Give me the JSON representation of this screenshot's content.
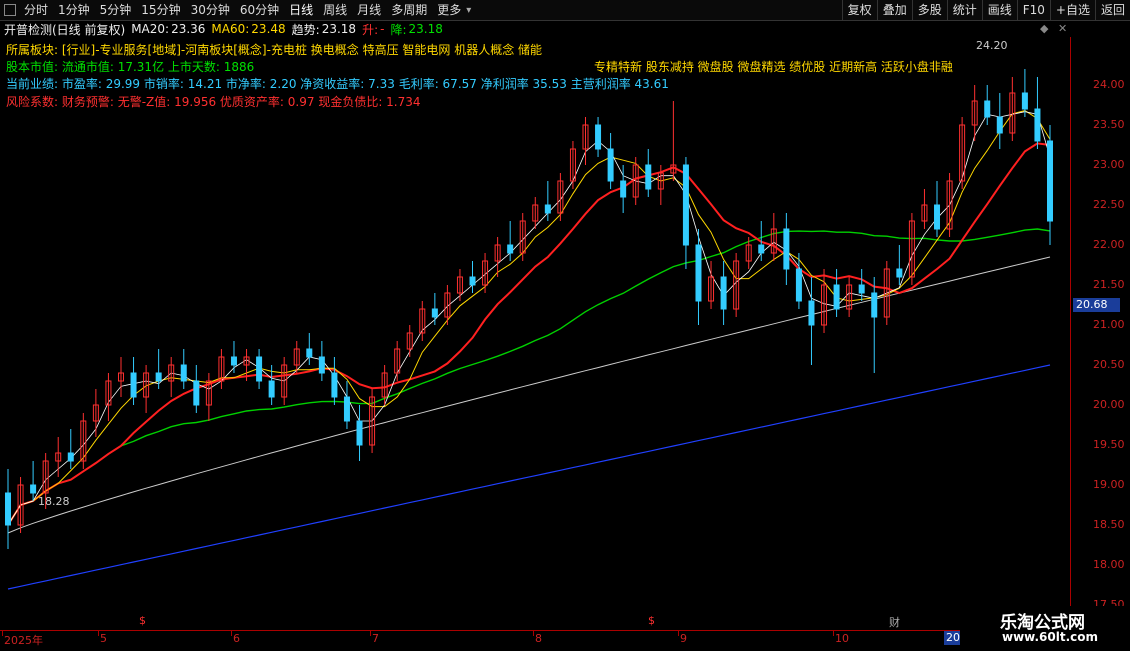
{
  "toolbar": {
    "periods": [
      "分时",
      "1分钟",
      "5分钟",
      "15分钟",
      "30分钟",
      "60分钟",
      "日线",
      "周线",
      "月线",
      "多周期",
      "更多"
    ],
    "active": "日线",
    "right_buttons": [
      "复权",
      "叠加",
      "多股",
      "统计",
      "画线",
      "F10",
      "+自选",
      "返回"
    ]
  },
  "info_bar": {
    "title": "开普检测(日线 前复权)",
    "ma20_label": "MA20:",
    "ma20_value": "23.36",
    "ma60_label": "MA60:",
    "ma60_value": "23.48",
    "trend_label": "趋势:",
    "trend_value": "23.18",
    "up_label": "升:",
    "up_value": "-",
    "down_label": "降:",
    "down_value": "23.18"
  },
  "info_lines": {
    "sector": "所属板块: [行业]-专业服务[地域]-河南板块[概念]-充电桩 换电概念 特高压 智能电网 机器人概念 储能",
    "market_cap": "股本市值: 流通市值: 17.31亿 上市天数: 1886",
    "performance": "当前业绩: 市盈率: 29.99 市销率: 14.21 市净率: 2.20 净资收益率: 7.33 毛利率: 67.57 净利润率 35.53 主营利润率 43.61",
    "risk": "风险系数: 财务预警: 无警-Z值: 19.956 优质资产率: 0.97 现金负债比: 1.734"
  },
  "tags": "专精特新 股东减持 微盘股 微盘精选 绩优股 近期新高 活跃小盘非融",
  "price_axis": {
    "ticks": [
      "24.00",
      "23.50",
      "23.00",
      "22.50",
      "22.00",
      "21.50",
      "21.00",
      "20.50",
      "20.00",
      "19.50",
      "19.00",
      "18.50",
      "18.00",
      "17.50"
    ],
    "current": "20.68"
  },
  "date_axis": {
    "labels": [
      "2025年",
      "5",
      "6",
      "7",
      "8",
      "9",
      "10"
    ],
    "badge": "2025/1"
  },
  "annotations": {
    "high": "24.20",
    "low": "18.28"
  },
  "event_markers": [
    "$",
    "$"
  ],
  "fin_marker": "财",
  "watermark": {
    "line1": "乐淘公式网",
    "line2": "www.60lt.com"
  },
  "colors": {
    "up": "#ff3030",
    "down": "#33ccff",
    "ma_yellow": "#ffd800",
    "ma_red": "#ff2020",
    "ma_green": "#00d000",
    "ma_grey": "#cccccc",
    "ma_blue": "#2040ff"
  },
  "chart_data": {
    "type": "candlestick",
    "ylim": [
      17.5,
      24.5
    ],
    "ohlc": [
      [
        18.9,
        19.2,
        18.2,
        18.5
      ],
      [
        18.5,
        19.1,
        18.4,
        19.0
      ],
      [
        19.0,
        19.3,
        18.8,
        18.9
      ],
      [
        18.9,
        19.4,
        18.7,
        19.3
      ],
      [
        19.3,
        19.6,
        19.1,
        19.4
      ],
      [
        19.4,
        19.7,
        19.2,
        19.3
      ],
      [
        19.3,
        19.9,
        19.2,
        19.8
      ],
      [
        19.8,
        20.2,
        19.6,
        20.0
      ],
      [
        20.0,
        20.4,
        19.8,
        20.3
      ],
      [
        20.3,
        20.6,
        20.1,
        20.4
      ],
      [
        20.4,
        20.6,
        20.0,
        20.1
      ],
      [
        20.1,
        20.5,
        19.9,
        20.4
      ],
      [
        20.4,
        20.7,
        20.2,
        20.3
      ],
      [
        20.3,
        20.6,
        20.1,
        20.5
      ],
      [
        20.5,
        20.7,
        20.2,
        20.3
      ],
      [
        20.3,
        20.5,
        19.9,
        20.0
      ],
      [
        20.0,
        20.4,
        19.8,
        20.3
      ],
      [
        20.3,
        20.7,
        20.2,
        20.6
      ],
      [
        20.6,
        20.8,
        20.4,
        20.5
      ],
      [
        20.5,
        20.7,
        20.3,
        20.6
      ],
      [
        20.6,
        20.7,
        20.2,
        20.3
      ],
      [
        20.3,
        20.5,
        20.0,
        20.1
      ],
      [
        20.1,
        20.6,
        20.0,
        20.5
      ],
      [
        20.5,
        20.8,
        20.4,
        20.7
      ],
      [
        20.7,
        20.9,
        20.5,
        20.6
      ],
      [
        20.6,
        20.8,
        20.3,
        20.4
      ],
      [
        20.4,
        20.6,
        20.0,
        20.1
      ],
      [
        20.1,
        20.3,
        19.7,
        19.8
      ],
      [
        19.8,
        20.0,
        19.3,
        19.5
      ],
      [
        19.5,
        20.2,
        19.4,
        20.1
      ],
      [
        20.1,
        20.5,
        20.0,
        20.4
      ],
      [
        20.4,
        20.8,
        20.3,
        20.7
      ],
      [
        20.7,
        21.0,
        20.6,
        20.9
      ],
      [
        20.9,
        21.3,
        20.8,
        21.2
      ],
      [
        21.2,
        21.4,
        21.0,
        21.1
      ],
      [
        21.1,
        21.5,
        21.0,
        21.4
      ],
      [
        21.4,
        21.7,
        21.3,
        21.6
      ],
      [
        21.6,
        21.8,
        21.4,
        21.5
      ],
      [
        21.5,
        21.9,
        21.4,
        21.8
      ],
      [
        21.8,
        22.1,
        21.6,
        22.0
      ],
      [
        22.0,
        22.3,
        21.8,
        21.9
      ],
      [
        21.9,
        22.4,
        21.8,
        22.3
      ],
      [
        22.3,
        22.6,
        22.2,
        22.5
      ],
      [
        22.5,
        22.8,
        22.3,
        22.4
      ],
      [
        22.4,
        22.9,
        22.3,
        22.8
      ],
      [
        22.8,
        23.3,
        22.7,
        23.2
      ],
      [
        23.2,
        23.6,
        23.0,
        23.5
      ],
      [
        23.5,
        23.6,
        23.1,
        23.2
      ],
      [
        23.2,
        23.4,
        22.7,
        22.8
      ],
      [
        22.8,
        23.0,
        22.4,
        22.6
      ],
      [
        22.6,
        23.1,
        22.5,
        23.0
      ],
      [
        23.0,
        23.2,
        22.6,
        22.7
      ],
      [
        22.7,
        23.0,
        22.5,
        22.9
      ],
      [
        22.9,
        23.8,
        22.8,
        23.0
      ],
      [
        23.0,
        23.1,
        21.7,
        22.0
      ],
      [
        22.0,
        22.2,
        21.0,
        21.3
      ],
      [
        21.3,
        21.8,
        21.2,
        21.6
      ],
      [
        21.6,
        21.8,
        21.0,
        21.2
      ],
      [
        21.2,
        21.9,
        21.1,
        21.8
      ],
      [
        21.8,
        22.1,
        21.7,
        22.0
      ],
      [
        22.0,
        22.3,
        21.8,
        21.9
      ],
      [
        21.9,
        22.4,
        21.8,
        22.2
      ],
      [
        22.2,
        22.4,
        21.5,
        21.7
      ],
      [
        21.7,
        21.9,
        21.2,
        21.3
      ],
      [
        21.3,
        21.6,
        20.5,
        21.0
      ],
      [
        21.0,
        21.7,
        20.9,
        21.5
      ],
      [
        21.5,
        21.7,
        21.1,
        21.2
      ],
      [
        21.2,
        21.6,
        21.1,
        21.5
      ],
      [
        21.5,
        21.7,
        21.3,
        21.4
      ],
      [
        21.4,
        21.6,
        20.4,
        21.1
      ],
      [
        21.1,
        21.8,
        21.0,
        21.7
      ],
      [
        21.7,
        22.0,
        21.5,
        21.6
      ],
      [
        21.6,
        22.4,
        21.5,
        22.3
      ],
      [
        22.3,
        22.7,
        22.2,
        22.5
      ],
      [
        22.5,
        22.8,
        22.1,
        22.2
      ],
      [
        22.2,
        22.9,
        22.1,
        22.8
      ],
      [
        22.8,
        23.6,
        22.7,
        23.5
      ],
      [
        23.5,
        24.0,
        23.3,
        23.8
      ],
      [
        23.8,
        24.0,
        23.5,
        23.6
      ],
      [
        23.6,
        23.9,
        23.2,
        23.4
      ],
      [
        23.4,
        24.1,
        23.3,
        23.9
      ],
      [
        23.9,
        24.2,
        23.6,
        23.7
      ],
      [
        23.7,
        24.1,
        23.2,
        23.3
      ],
      [
        23.3,
        23.5,
        22.0,
        22.3
      ]
    ]
  }
}
